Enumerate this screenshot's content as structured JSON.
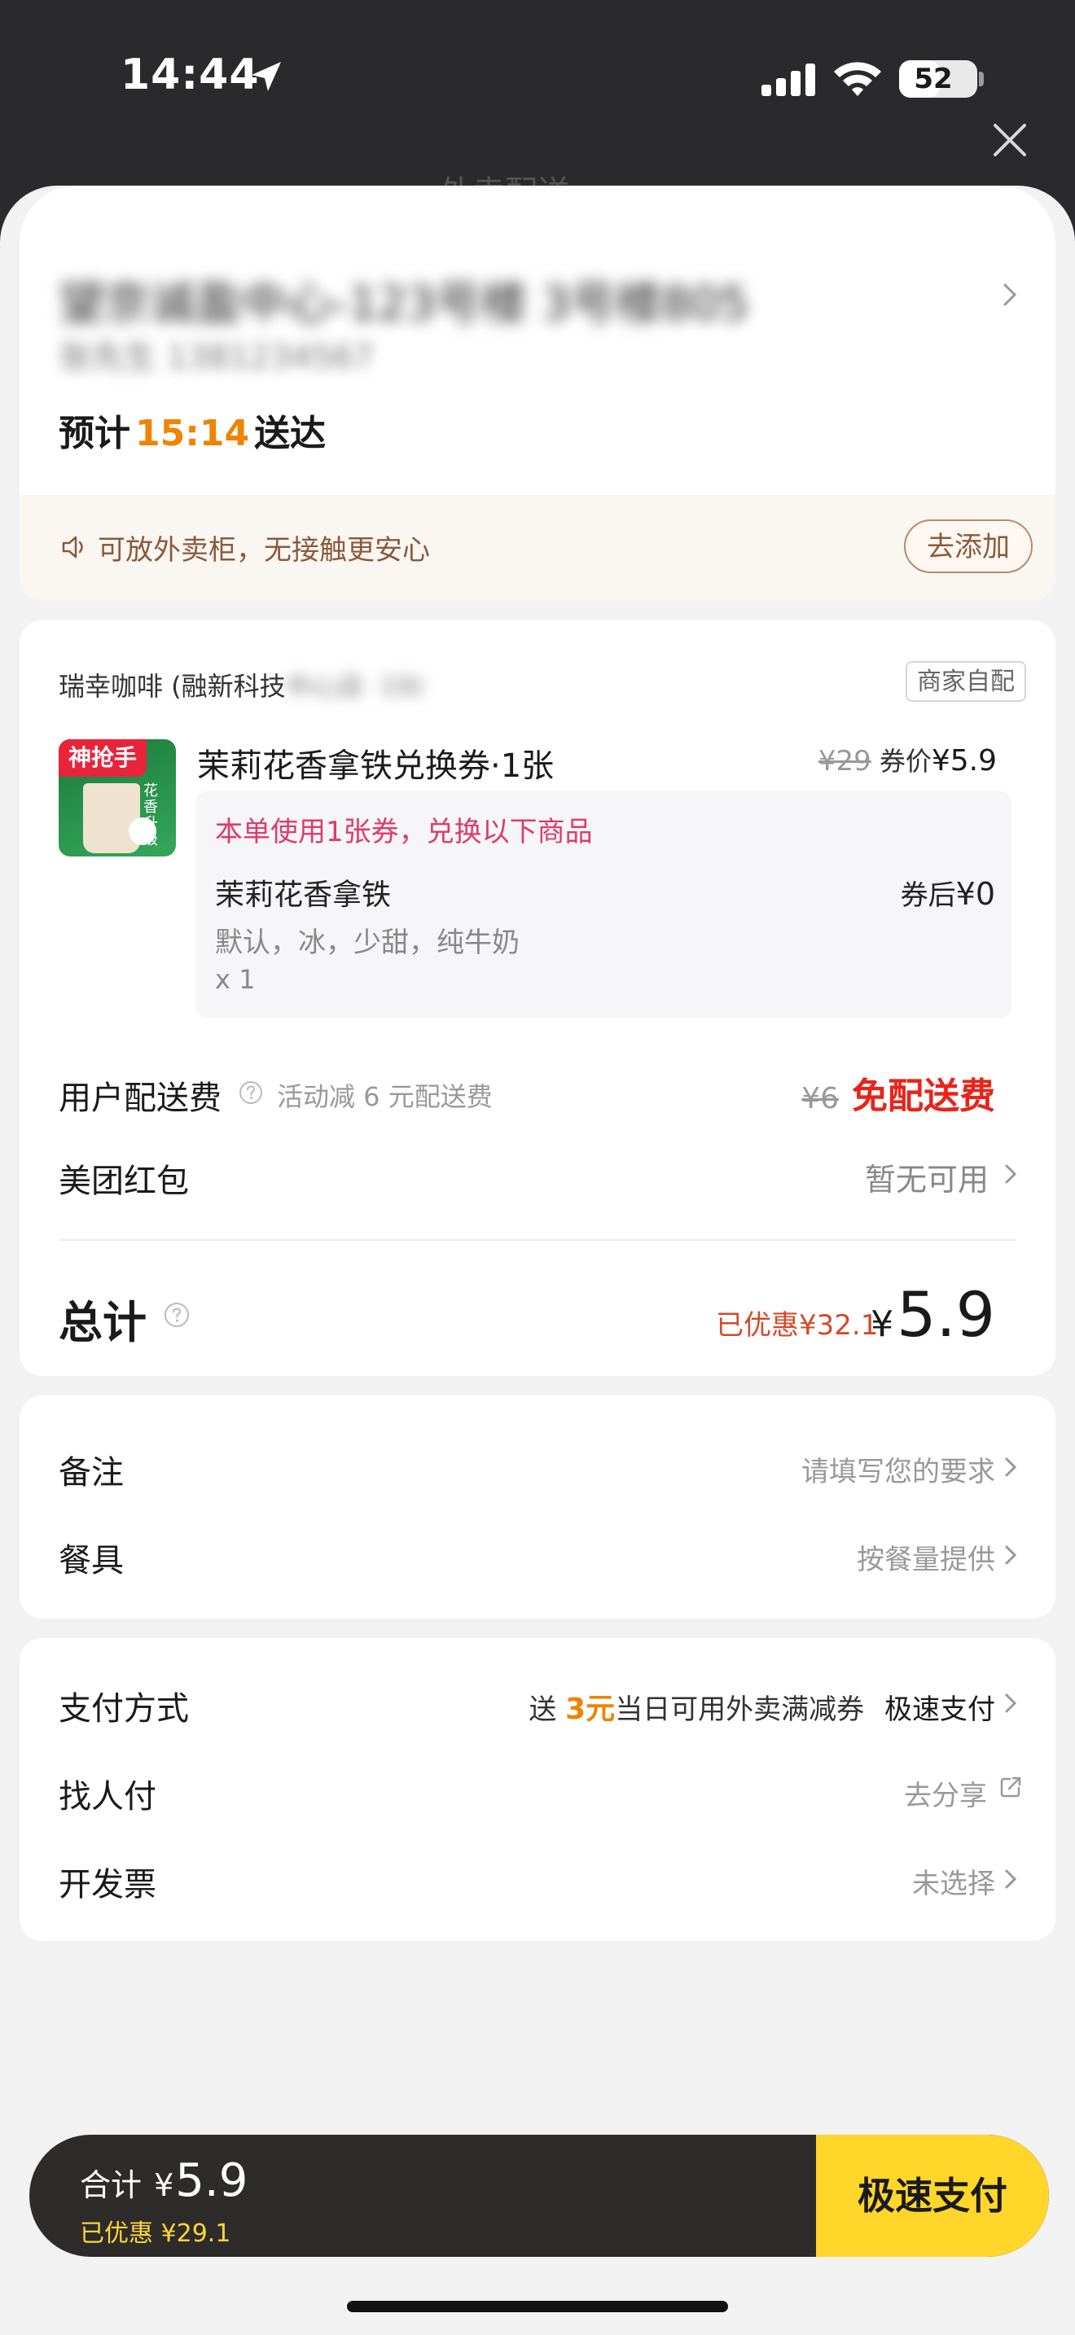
{
  "status_bar": {
    "time": "14:44",
    "battery": "52",
    "battery_fraction": 0.52
  },
  "background_title": "外卖配送",
  "address": {
    "line1": "望京诚盈中心-123号楼 3号楼805",
    "line2": "张先生 1381234567",
    "eta_prefix": "预计",
    "eta_time": "15:14",
    "eta_suffix": "送达",
    "tip_text": "可放外卖柜，无接触更安心",
    "tip_button": "去添加"
  },
  "order": {
    "store_name": "瑞幸咖啡 (融新科技",
    "store_name_blurred": "中心店 ·19)",
    "store_tag": "商家自配",
    "thumb_badge": "神抢手",
    "thumb_side": "花香升级",
    "item_name": "茉莉花香拿铁兑换券·1张",
    "item_old_price": "¥29",
    "item_price_label": "券价",
    "item_price": "¥5.9",
    "exchange_note": "本单使用1张券，兑换以下商品",
    "exchange_item": "茉莉花香拿铁",
    "exchange_price_label": "券后",
    "exchange_price": "¥0",
    "exchange_spec": "默认，冰，少甜，纯牛奶",
    "exchange_qty": "x 1",
    "fee_label": "用户配送费",
    "fee_desc": "活动减 6 元配送费",
    "fee_old": "¥6",
    "fee_value": "免配送费",
    "redpack_label": "美团红包",
    "redpack_value": "暂无可用",
    "total_label": "总计",
    "total_saved": "已优惠¥32.1",
    "total_currency": "¥",
    "total_amount": "5.9"
  },
  "notes": {
    "remark_label": "备注",
    "remark_placeholder": "请填写您的要求",
    "tableware_label": "餐具",
    "tableware_value": "按餐量提供"
  },
  "payment": {
    "method_label": "支付方式",
    "promo_prefix": "送",
    "promo_amount": "3元",
    "promo_suffix": "当日可用外卖满减券",
    "method_value": "极速支付",
    "share_label": "找人付",
    "share_value": "去分享",
    "invoice_label": "开发票",
    "invoice_value": "未选择"
  },
  "bottom_bar": {
    "total_label": "合计",
    "currency": "¥",
    "total": "5.9",
    "saved": "已优惠 ¥29.1",
    "pay_button": "极速支付"
  },
  "colors": {
    "accent_orange": "#f08300",
    "price_red": "#e8241a",
    "pay_yellow": "#ffd629",
    "note_pink": "#e03a6a"
  }
}
